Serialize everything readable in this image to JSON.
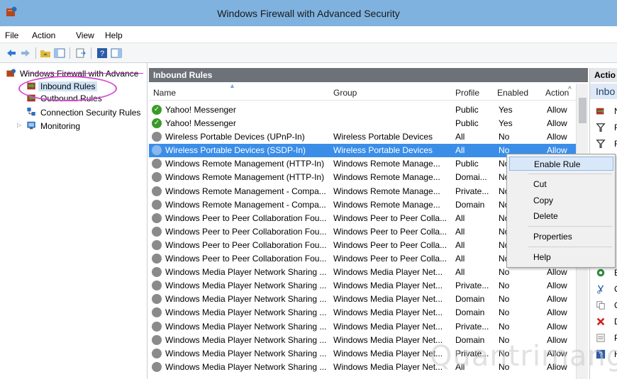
{
  "window": {
    "title": "Windows Firewall with Advanced Security"
  },
  "menu": [
    "File",
    "Action",
    "View",
    "Help"
  ],
  "tree": [
    {
      "label": "Windows Firewall with Advance",
      "icon": "firewall-root-icon"
    },
    {
      "label": "Inbound Rules",
      "icon": "inbound-rules-icon"
    },
    {
      "label": "Outbound Rules",
      "icon": "outbound-rules-icon"
    },
    {
      "label": "Connection Security Rules",
      "icon": "connection-security-icon"
    },
    {
      "label": "Monitoring",
      "icon": "monitoring-icon"
    }
  ],
  "panel": {
    "title": "Inbound Rules",
    "columns": [
      "Name",
      "Group",
      "Profile",
      "Enabled",
      "Action"
    ]
  },
  "rules": [
    {
      "name": "Yahoo! Messenger",
      "group": "",
      "profile": "Public",
      "enabled": "Yes",
      "action": "Allow",
      "state": "enabled"
    },
    {
      "name": "Yahoo! Messenger",
      "group": "",
      "profile": "Public",
      "enabled": "Yes",
      "action": "Allow",
      "state": "enabled"
    },
    {
      "name": "Wireless Portable Devices (UPnP-In)",
      "group": "Wireless Portable Devices",
      "profile": "All",
      "enabled": "No",
      "action": "Allow",
      "state": "disabled"
    },
    {
      "name": "Wireless Portable Devices (SSDP-In)",
      "group": "Wireless Portable Devices",
      "profile": "All",
      "enabled": "No",
      "action": "Allow",
      "state": "disabled"
    },
    {
      "name": "Windows Remote Management (HTTP-In)",
      "group": "Windows Remote Manage...",
      "profile": "Public",
      "enabled": "No",
      "action": "",
      "state": "disabled"
    },
    {
      "name": "Windows Remote Management (HTTP-In)",
      "group": "Windows Remote Manage...",
      "profile": "Domai...",
      "enabled": "No",
      "action": "",
      "state": "disabled"
    },
    {
      "name": "Windows Remote Management - Compa...",
      "group": "Windows Remote Manage...",
      "profile": "Private...",
      "enabled": "No",
      "action": "",
      "state": "disabled"
    },
    {
      "name": "Windows Remote Management - Compa...",
      "group": "Windows Remote Manage...",
      "profile": "Domain",
      "enabled": "No",
      "action": "",
      "state": "disabled"
    },
    {
      "name": "Windows Peer to Peer Collaboration Fou...",
      "group": "Windows Peer to Peer Colla...",
      "profile": "All",
      "enabled": "No",
      "action": "",
      "state": "disabled"
    },
    {
      "name": "Windows Peer to Peer Collaboration Fou...",
      "group": "Windows Peer to Peer Colla...",
      "profile": "All",
      "enabled": "No",
      "action": "",
      "state": "disabled"
    },
    {
      "name": "Windows Peer to Peer Collaboration Fou...",
      "group": "Windows Peer to Peer Colla...",
      "profile": "All",
      "enabled": "No",
      "action": "",
      "state": "disabled"
    },
    {
      "name": "Windows Peer to Peer Collaboration Fou...",
      "group": "Windows Peer to Peer Colla...",
      "profile": "All",
      "enabled": "No",
      "action": "",
      "state": "disabled"
    },
    {
      "name": "Windows Media Player Network Sharing ...",
      "group": "Windows Media Player Net...",
      "profile": "All",
      "enabled": "No",
      "action": "Allow",
      "state": "disabled"
    },
    {
      "name": "Windows Media Player Network Sharing ...",
      "group": "Windows Media Player Net...",
      "profile": "Private...",
      "enabled": "No",
      "action": "Allow",
      "state": "disabled"
    },
    {
      "name": "Windows Media Player Network Sharing ...",
      "group": "Windows Media Player Net...",
      "profile": "Domain",
      "enabled": "No",
      "action": "Allow",
      "state": "disabled"
    },
    {
      "name": "Windows Media Player Network Sharing ...",
      "group": "Windows Media Player Net...",
      "profile": "Domain",
      "enabled": "No",
      "action": "Allow",
      "state": "disabled"
    },
    {
      "name": "Windows Media Player Network Sharing ...",
      "group": "Windows Media Player Net...",
      "profile": "Private...",
      "enabled": "No",
      "action": "Allow",
      "state": "disabled"
    },
    {
      "name": "Windows Media Player Network Sharing ...",
      "group": "Windows Media Player Net...",
      "profile": "Domain",
      "enabled": "No",
      "action": "Allow",
      "state": "disabled"
    },
    {
      "name": "Windows Media Player Network Sharing ...",
      "group": "Windows Media Player Net...",
      "profile": "Private...",
      "enabled": "No",
      "action": "Allow",
      "state": "disabled"
    },
    {
      "name": "Windows Media Player Network Sharing ...",
      "group": "Windows Media Player Net...",
      "profile": "All",
      "enabled": "No",
      "action": "Allow",
      "state": "disabled"
    }
  ],
  "selected_row": 3,
  "actions_pane": {
    "title": "Actio",
    "subheader": "Inbo"
  },
  "context_menu": {
    "items": [
      "Enable Rule",
      "Cut",
      "Copy",
      "Delete",
      "Properties",
      "Help"
    ],
    "highlighted": "Enable Rule"
  },
  "watermark": "Quantrimang",
  "colors": {
    "titlebar": "#7fb2df",
    "selection": "#3b8ee8",
    "enabled_icon": "#3a9a2a",
    "disabled_icon": "#8a8a8a",
    "annotation": "#d44bd4"
  }
}
